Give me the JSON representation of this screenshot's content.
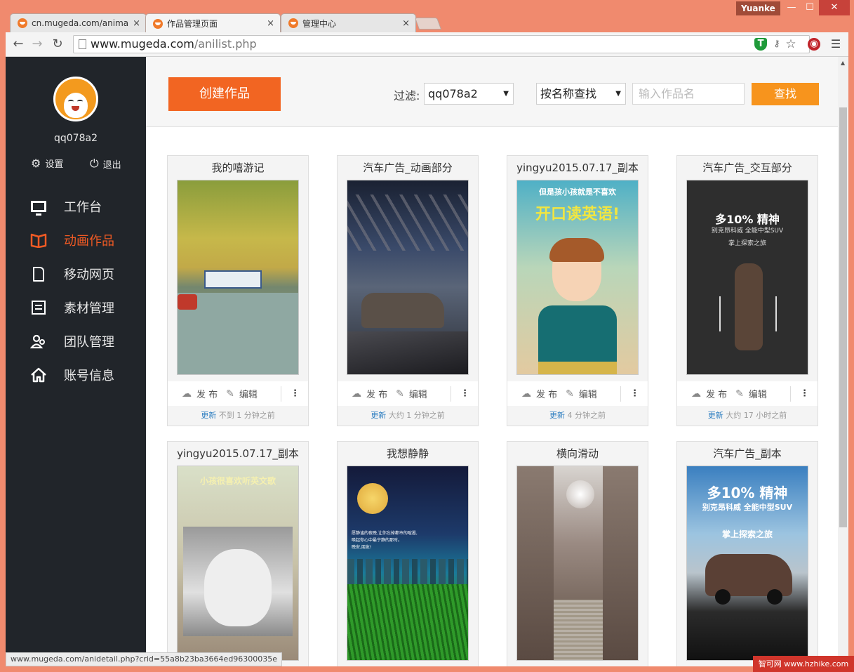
{
  "browser": {
    "tabs": [
      {
        "title": "cn.mugeda.com/animat",
        "close": "×"
      },
      {
        "title": "作品管理页面",
        "close": "×"
      },
      {
        "title": "管理中心",
        "close": "×"
      }
    ],
    "user": "Yuanke",
    "min": "—",
    "max": "☐",
    "close": "✕",
    "url_host": "www.mugeda.com",
    "url_path": "/anilist.php",
    "status_url": "www.mugeda.com/anidetail.php?crid=55a8b23ba3664ed96300035e"
  },
  "sidebar": {
    "username": "qq078a2",
    "settings_label": "设置",
    "logout_label": "退出",
    "items": [
      {
        "label": "工作台",
        "icon": "monitor-icon"
      },
      {
        "label": "动画作品",
        "icon": "book-icon",
        "active": true
      },
      {
        "label": "移动网页",
        "icon": "document-icon"
      },
      {
        "label": "素材管理",
        "icon": "list-icon"
      },
      {
        "label": "团队管理",
        "icon": "team-icon"
      },
      {
        "label": "账号信息",
        "icon": "home-icon"
      }
    ]
  },
  "toolbar": {
    "create_label": "创建作品",
    "filter_label": "过滤:",
    "filter_value": "qq078a2",
    "search_mode": "按名称查找",
    "search_placeholder": "输入作品名",
    "search_label": "查找"
  },
  "card_common": {
    "publish": "发 布",
    "edit": "编辑",
    "more": "⋮",
    "updated": "更新"
  },
  "works": [
    {
      "title": "我的嘻游记",
      "time": "不到 1 分钟之前"
    },
    {
      "title": "汽车广告_动画部分",
      "time": "大约 1 分钟之前"
    },
    {
      "title": "yingyu2015.07.17_副本",
      "time": "4 分钟之前",
      "overlay1": "但是孩小孩就是不喜欢",
      "overlay2": "开口读英语!"
    },
    {
      "title": "汽车广告_交互部分",
      "time": "大约 17 小时之前",
      "overlay1": "多10% 精神",
      "overlay2": "别克昂科威 全能中型SUV",
      "overlay3": "掌上探索之旅"
    },
    {
      "title": "yingyu2015.07.17_副本",
      "overlay1": "小孩很喜欢听英文歌"
    },
    {
      "title": "我想静静",
      "overlay1": "愿静谧的夜晚,让你忘掉都市的喧嚣,",
      "overlay2": "唤起你心中最宁静的那时。",
      "overlay3": "晚安,朋友!"
    },
    {
      "title": "横向滑动"
    },
    {
      "title": "汽车广告_副本",
      "overlay1": "多10% 精神",
      "overlay2": "别克昂科威 全能中型SUV",
      "overlay3": "掌上探索之旅"
    }
  ],
  "watermark": "智可网 www.hzhike.com",
  "colors": {
    "accent": "#f26522",
    "search": "#f7941d",
    "sidebar": "#21252a",
    "link": "#2f7fc1"
  }
}
